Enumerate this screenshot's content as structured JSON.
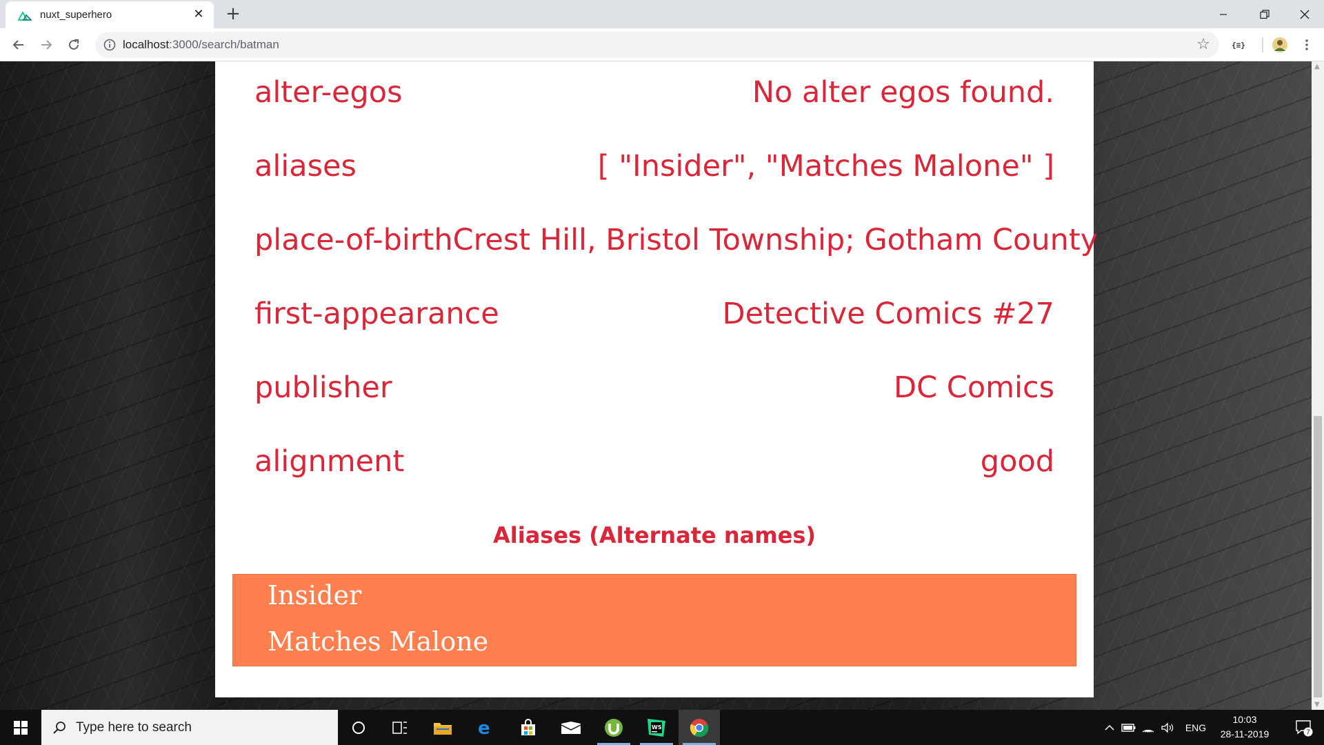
{
  "browser": {
    "tab_title": "nuxt_superhero",
    "url_host": "localhost",
    "url_path": ":3000/search/batman",
    "colors": {
      "tabbar": "#dee1e6",
      "omnibox": "#f1f3f4"
    }
  },
  "hero": {
    "rows": [
      {
        "key": "alter-egos",
        "value": "No alter egos found."
      },
      {
        "key": "aliases",
        "value": "[ \"Insider\", \"Matches Malone\" ]"
      },
      {
        "key": "place-of-birth",
        "value": "Crest Hill, Bristol Township; Gotham County"
      },
      {
        "key": "first-appearance",
        "value": "Detective Comics #27"
      },
      {
        "key": "publisher",
        "value": "DC Comics"
      },
      {
        "key": "alignment",
        "value": "good"
      }
    ],
    "aliases_heading": "Aliases (Alternate names)",
    "aliases": [
      "Insider",
      "Matches Malone"
    ],
    "colors": {
      "text": "#d92638",
      "alias_box": "#ff7f4f"
    }
  },
  "taskbar": {
    "search_placeholder": "Type here to search",
    "language": "ENG",
    "time": "10:03",
    "date": "28-11-2019",
    "notifications": "7",
    "apps": [
      "cortana-icon",
      "task-view-icon",
      "file-explorer-icon",
      "edge-icon",
      "store-icon",
      "mail-icon",
      "utorrent-icon",
      "webstorm-icon",
      "chrome-icon"
    ]
  }
}
